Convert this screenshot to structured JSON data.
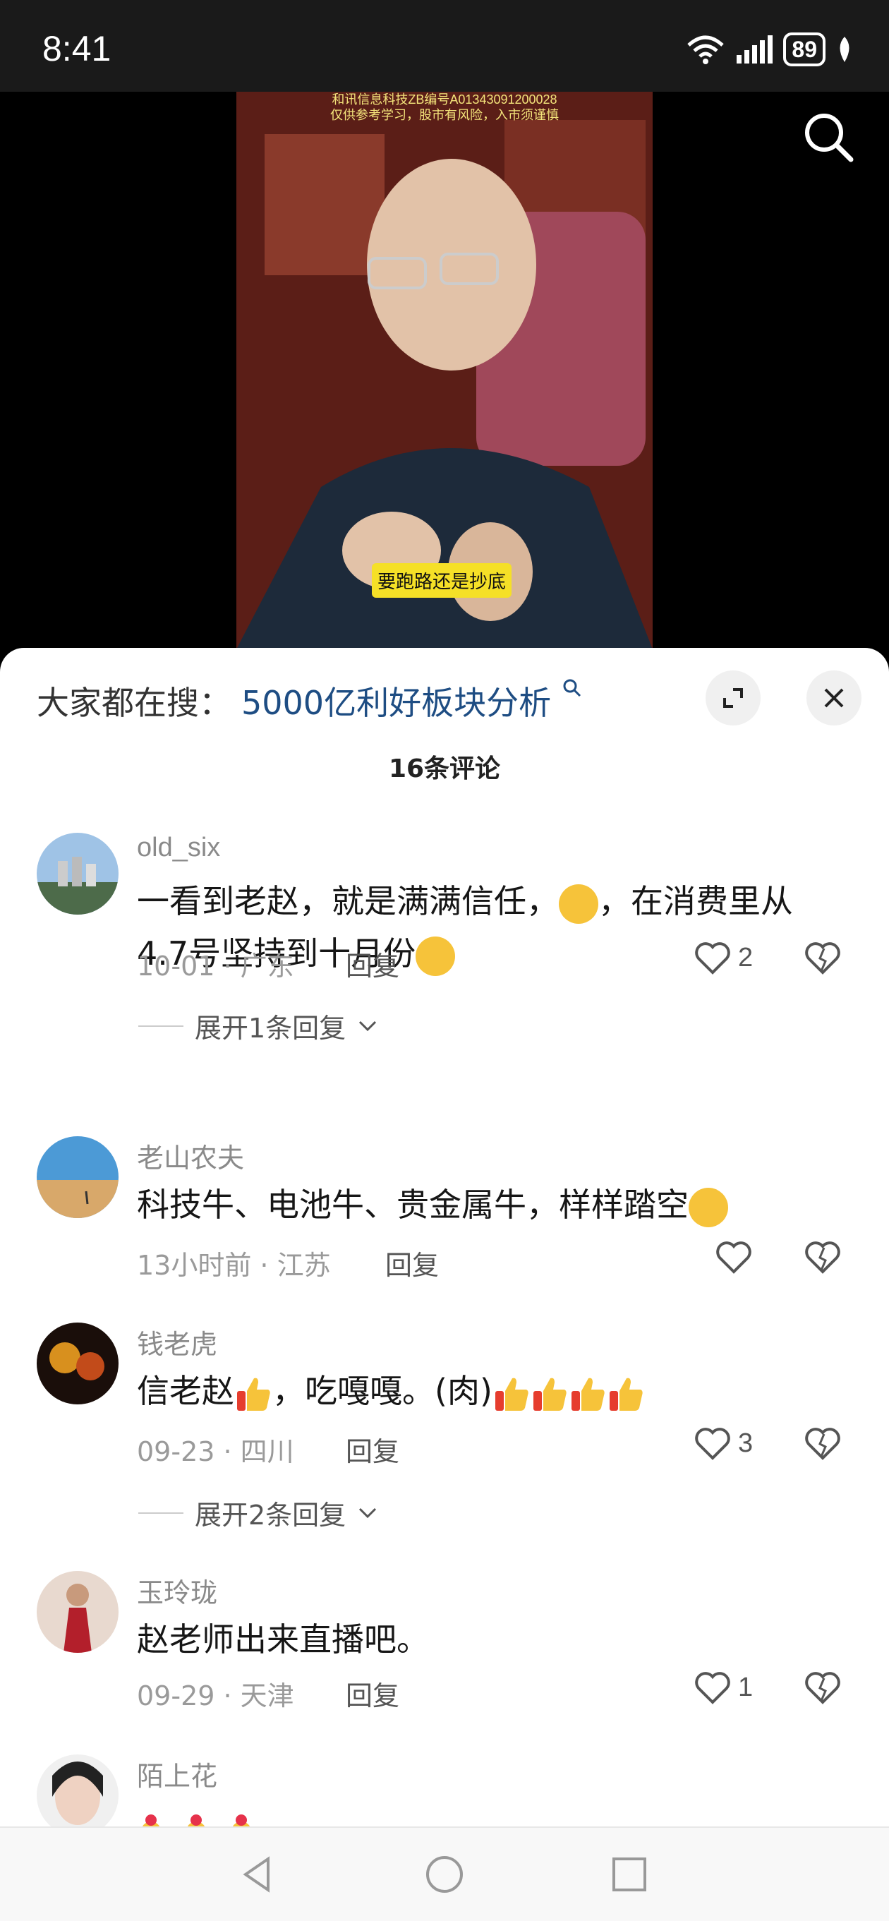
{
  "status": {
    "time": "8:41",
    "battery": "89"
  },
  "video": {
    "top_text": "和讯信息科技ZB编号A01343091200028\n仅供参考学习，股市有风险，入市须谨慎",
    "caption": "要跑路还是抄底"
  },
  "sheet": {
    "trend_label": "大家都在搜：",
    "trend_query": "5000亿利好板块分析",
    "comment_count": "16条评论"
  },
  "comments": [
    {
      "user": "old_six",
      "text": "一看到老赵，就是满满信任，",
      "text2": "，在消费里从",
      "text3": "4.7号坚持到十月份",
      "date": "10-01 · 广东",
      "reply": "回复",
      "likes": "2",
      "expand": "展开1条回复"
    },
    {
      "user": "老山农夫",
      "text": "科技牛、电池牛、贵金属牛，样样踏空",
      "date": "13小时前 · 江苏",
      "reply": "回复",
      "likes": ""
    },
    {
      "user": "钱老虎",
      "text": "信老赵",
      "text2": "，吃嘎嘎。(肉)",
      "date": "09-23 · 四川",
      "reply": "回复",
      "likes": "3",
      "expand": "展开2条回复"
    },
    {
      "user": "玉玲珑",
      "text": "赵老师出来直播吧。",
      "date": "09-29 · 天津",
      "reply": "回复",
      "likes": "1"
    },
    {
      "user": "陌上花",
      "text": ""
    }
  ],
  "colors": {
    "accent_link": "#1e4d83",
    "caption_bg": "#f5e027"
  },
  "icons": [
    "search-icon",
    "expand-icon",
    "close-icon",
    "heart-icon",
    "dislike-heart-icon",
    "chevron-down-icon",
    "back-nav-icon",
    "home-nav-icon",
    "recents-nav-icon"
  ]
}
